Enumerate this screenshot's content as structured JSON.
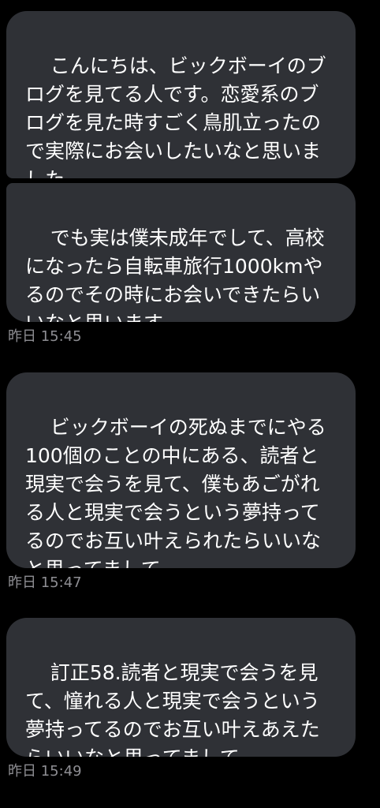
{
  "messages": [
    {
      "text": "こんにちは、ビックボーイのブログを見てる人です。恋愛系のブログを見た時すごく鳥肌立ったので実際にお会いしたいなと思いました"
    },
    {
      "text": "でも実は僕未成年でして、高校になったら自転車旅行1000kmやるのでその時にお会いできたらいいなと思います"
    },
    {
      "text": "ビックボーイの死ぬまでにやる100個のことの中にある、読者と現実で会うを見て、僕もあごがれる人と現実で会うという夢持ってるのでお互い叶えられたらいいなと思ってまして"
    },
    {
      "text": "訂正58.読者と現実で会うを見て、憧れる人と現実で会うという夢持ってるのでお互い叶えあえたらいいなと思ってまして"
    }
  ],
  "timestamps": [
    "昨日 15:45",
    "昨日 15:47",
    "昨日 15:49"
  ]
}
